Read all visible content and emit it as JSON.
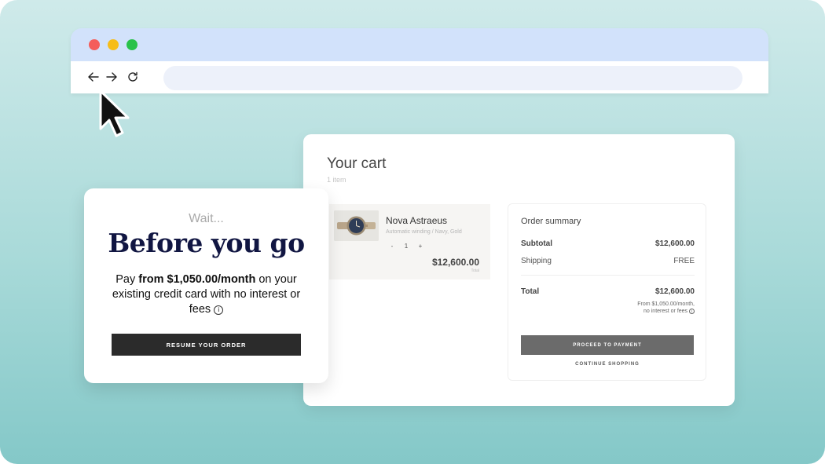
{
  "colors": {
    "background_top": "#cfeaea",
    "background_bottom": "#84c8c8",
    "titlebar": "#d2e2fb",
    "urlbar": "#edf1fa",
    "heading_navy": "#111642",
    "primary_button": "#2b2b2b",
    "secondary_button": "#6b6b6b"
  },
  "browser": {
    "icons": [
      "arrow-left-icon",
      "arrow-right-icon",
      "reload-icon"
    ],
    "url": ""
  },
  "cart": {
    "title": "Your cart",
    "count": "1 item",
    "item": {
      "name": "Nova Astraeus",
      "variant": "Automatic winding / Navy, Gold",
      "qty_minus": "-",
      "qty_value": "1",
      "qty_plus": "+",
      "price": "$12,600.00",
      "price_sub": "Total"
    },
    "summary": {
      "title": "Order summary",
      "subtotal_label": "Subtotal",
      "subtotal_value": "$12,600.00",
      "shipping_label": "Shipping",
      "shipping_value": "FREE",
      "total_label": "Total",
      "total_value": "$12,600.00",
      "finance_line1": "From $1,050.00/month,",
      "finance_line2": "no interest or fees",
      "pay_button": "PROCEED TO PAYMENT",
      "continue_link": "CONTINUE SHOPPING"
    }
  },
  "popup": {
    "wait": "Wait...",
    "heading": "Before you go",
    "body_prefix": "Pay ",
    "body_bold": "from $1,050.00/month",
    "body_suffix": " on your existing credit card with no interest or fees",
    "info_glyph": "i",
    "resume_button": "RESUME YOUR ORDER"
  }
}
